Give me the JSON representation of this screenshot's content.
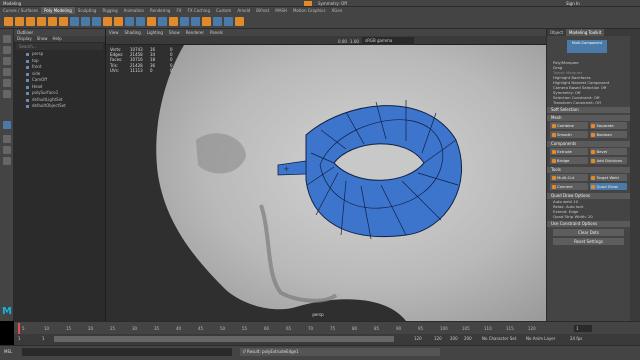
{
  "app": {
    "workspace": "Modeling",
    "menuset_search": "Symmetry: Off",
    "sign_in": "Sign In"
  },
  "shelf_tabs": [
    "Curves / Surfaces",
    "Poly Modeling",
    "Sculpting",
    "Rigging",
    "Animation",
    "Rendering",
    "FX",
    "FX Caching",
    "Custom",
    "Arnold",
    "Bifrost",
    "MASH",
    "Motion Graphics",
    "XGen"
  ],
  "outliner": {
    "title": "Outliner",
    "menus": [
      "Display",
      "Show",
      "Help"
    ],
    "search_placeholder": "Search...",
    "items": [
      "persp",
      "top",
      "front",
      "side",
      "CamOff",
      "Head",
      "polySurface1",
      "defaultLightSet",
      "defaultObjectSet"
    ]
  },
  "viewport": {
    "menus": [
      "View",
      "Shading",
      "Lighting",
      "Show",
      "Renderer",
      "Panels"
    ],
    "hud_rows": [
      {
        "label": "Verts:",
        "a": "10743",
        "b": "16",
        "c": "0"
      },
      {
        "label": "Edges:",
        "a": "21458",
        "b": "34",
        "c": "0"
      },
      {
        "label": "Faces:",
        "a": "10716",
        "b": "18",
        "c": "0"
      },
      {
        "label": "Tris:",
        "a": "21428",
        "b": "36",
        "c": "0"
      },
      {
        "label": "UVs:",
        "a": "11113",
        "b": "0",
        "c": "0"
      }
    ],
    "camera_value": "0.00",
    "scale_value": "1.00",
    "colorspace": "sRGB gamma",
    "camera_label": "persp"
  },
  "modeling_toolkit": {
    "tabs": [
      "Object",
      "Modeling Toolkit"
    ],
    "component_label": "Multi-Component",
    "poly_label": "Poly/Marquee",
    "drag_label": "Drag",
    "tweak_label": "Tweak Marquee",
    "highlight_backfaces": "Highlight Backfaces",
    "highlight_nearest": "Highlight Nearest Component",
    "camera_based": "Camera Based Selection",
    "camera_based_value": "Off",
    "symmetry_label": "Symmetry:",
    "symmetry_value": "Off",
    "selection_constraint": "Selection Constraint:",
    "selection_constraint_value": "Off",
    "transform_constraint": "Transform Constraint:",
    "transform_constraint_value": "Off",
    "soft_selection": "Soft Selection",
    "mesh_section": "Mesh",
    "mesh_buttons": [
      "Combine",
      "Separate",
      "Smooth",
      "Boolean"
    ],
    "components_section": "Components",
    "component_buttons": [
      "Extrude",
      "Bevel",
      "Bridge",
      "Add Divisions"
    ],
    "tools_section": "Tools",
    "tool_buttons": [
      "Multi-Cut",
      "Target Weld",
      "Connect",
      "Quad Draw"
    ],
    "quad_draw_options": "Quad Draw Options",
    "auto_weld": "Auto weld",
    "auto_weld_value": "10",
    "relax": "Relax:",
    "relax_value": "Auto lock",
    "extend": "Extend:",
    "extend_value": "Edge",
    "quad_strip_width": "Quad Strip Width:",
    "quad_strip_value": "20",
    "use_constraint": "Use Constraint Options",
    "clear_dots": "Clear Dots",
    "reset_settings": "Reset Settings"
  },
  "timeline": {
    "ticks": [
      "5",
      "10",
      "15",
      "20",
      "25",
      "30",
      "35",
      "40",
      "45",
      "50",
      "55",
      "60",
      "65",
      "70",
      "75",
      "80",
      "85",
      "90",
      "95",
      "100",
      "105",
      "110",
      "115",
      "120"
    ],
    "current_frame": "1"
  },
  "range": {
    "start": "1",
    "inner_start": "1",
    "inner_end": "120",
    "end": "120",
    "end2": "200",
    "end3": "200",
    "char_set": "No Character Set",
    "anim_layer": "No Anim Layer",
    "fps": "24 fps"
  },
  "command": {
    "mode": "MEL",
    "result": "// Result: polyExtrudeEdge1"
  }
}
